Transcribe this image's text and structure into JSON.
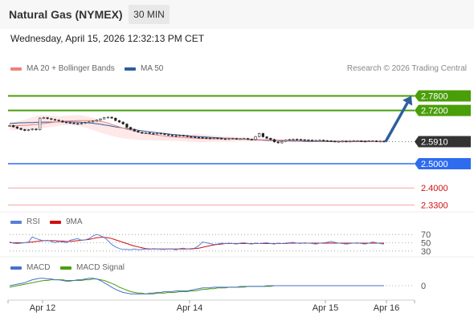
{
  "header": {
    "title": "Natural Gas (NYMEX)",
    "timeframe": "30 MIN"
  },
  "datetime": "Wednesday, April 15, 2026 12:32:13 PM CET",
  "legend": {
    "ma20": "MA 20 + Bollinger Bands",
    "ma50": "MA 50",
    "rsi": "RSI",
    "rsi_ma": "9MA",
    "macd": "MACD",
    "macd_signal": "MACD Signal"
  },
  "credit": "Research © 2026 Trading Central",
  "colors": {
    "resistance": "#4a9e0a",
    "support": "#2f6bef",
    "support_weak": "#f4a6a6",
    "current": "#333333",
    "ma20": "#f08080",
    "ma50": "#2e5e9e",
    "bollinger_fill": "#fde0e0",
    "rsi": "#5b7fd6",
    "rsi_ma": "#d01010",
    "macd": "#4a6fd0",
    "macd_signal": "#4a9e0a",
    "arrow": "#2e5e9e",
    "up_candle": "#1c1c1c",
    "down_candle": "#c0392b"
  },
  "chart_data": [
    {
      "type": "candlestick",
      "title": "Natural Gas (NYMEX)",
      "timeframe": "30 MIN",
      "x_ticks": [
        "Apr 12",
        "Apr 14",
        "Apr 15",
        "Apr 16"
      ],
      "price_levels": [
        {
          "label": "2.7800",
          "value": 2.78,
          "kind": "resistance"
        },
        {
          "label": "2.7200",
          "value": 2.72,
          "kind": "resistance"
        },
        {
          "label": "2.5910",
          "value": 2.591,
          "kind": "current"
        },
        {
          "label": "2.5000",
          "value": 2.5,
          "kind": "support"
        },
        {
          "label": "2.4000",
          "value": 2.4,
          "kind": "support_weak"
        },
        {
          "label": "2.3300",
          "value": 2.33,
          "kind": "support_weak"
        }
      ],
      "ylim": [
        2.308,
        2.861
      ],
      "close_series": [
        2.658,
        2.652,
        2.646,
        2.641,
        2.637,
        2.64,
        2.643,
        2.64,
        2.688,
        2.69,
        2.686,
        2.683,
        2.68,
        2.677,
        2.672,
        2.67,
        2.668,
        2.666,
        2.664,
        2.667,
        2.67,
        2.673,
        2.676,
        2.68,
        2.685,
        2.69,
        2.692,
        2.688,
        2.678,
        2.672,
        2.664,
        2.65,
        2.642,
        2.635,
        2.63,
        2.626,
        2.628,
        2.625,
        2.623,
        2.626,
        2.624,
        2.62,
        2.618,
        2.616,
        2.614,
        2.617,
        2.615,
        2.612,
        2.611,
        2.609,
        2.608,
        2.607,
        2.606,
        2.605,
        2.606,
        2.605,
        2.603,
        2.602,
        2.603,
        2.604,
        2.603,
        2.603,
        2.604,
        2.601,
        2.6,
        2.612,
        2.625,
        2.611,
        2.605,
        2.6,
        2.59,
        2.586,
        2.592,
        2.597,
        2.6,
        2.601,
        2.6,
        2.599,
        2.598,
        2.597,
        2.596,
        2.596,
        2.597,
        2.595,
        2.594,
        2.593,
        2.592,
        2.592,
        2.593,
        2.592,
        2.593,
        2.594,
        2.594,
        2.593,
        2.592,
        2.594,
        2.594,
        2.592,
        2.593,
        2.591
      ],
      "ma20": [
        2.655,
        2.656,
        2.657,
        2.658,
        2.658,
        2.659,
        2.661,
        2.662,
        2.664,
        2.666,
        2.668,
        2.67,
        2.672,
        2.673,
        2.675,
        2.676,
        2.677,
        2.677,
        2.678,
        2.678,
        2.678,
        2.678,
        2.678,
        2.677,
        2.675,
        2.672,
        2.668,
        2.662,
        2.657,
        2.652,
        2.647,
        2.642,
        2.638,
        2.634,
        2.631,
        2.628,
        2.625,
        2.622,
        2.62,
        2.618,
        2.616,
        2.614,
        2.612,
        2.611,
        2.61,
        2.609,
        2.608,
        2.607,
        2.606,
        2.605,
        2.604,
        2.604,
        2.603,
        2.603,
        2.603,
        2.603,
        2.604,
        2.605,
        2.605,
        2.605,
        2.604,
        2.603,
        2.602,
        2.601,
        2.6,
        2.599,
        2.599,
        2.598,
        2.598,
        2.598,
        2.597,
        2.597,
        2.597,
        2.596,
        2.596,
        2.596,
        2.595,
        2.595,
        2.595,
        2.595,
        2.594,
        2.594,
        2.594,
        2.594,
        2.594,
        2.593,
        2.593,
        2.593,
        2.593,
        2.593,
        2.593,
        2.593,
        2.593,
        2.593,
        2.593,
        2.593,
        2.592,
        2.592,
        2.592,
        2.592
      ],
      "ma50": [
        2.666,
        2.667,
        2.668,
        2.669,
        2.669,
        2.67,
        2.67,
        2.671,
        2.671,
        2.672,
        2.672,
        2.672,
        2.672,
        2.673,
        2.673,
        2.673,
        2.673,
        2.672,
        2.672,
        2.671,
        2.67,
        2.669,
        2.667,
        2.665,
        2.663,
        2.66,
        2.658,
        2.655,
        2.652,
        2.65,
        2.647,
        2.645,
        2.643,
        2.641,
        2.638,
        2.636,
        2.634,
        2.632,
        2.63,
        2.628,
        2.626,
        2.625,
        2.623,
        2.621,
        2.62,
        2.618,
        2.617,
        2.616,
        2.614,
        2.613,
        2.612,
        2.611,
        2.61,
        2.609,
        2.608,
        2.607,
        2.606,
        2.605,
        2.605,
        2.604,
        2.603,
        2.602,
        2.601,
        2.6,
        2.599,
        2.598,
        2.598,
        2.597,
        2.596,
        2.596,
        2.595,
        2.595,
        2.594,
        2.594,
        2.594,
        2.593,
        2.593,
        2.593,
        2.592,
        2.592,
        2.592,
        2.592,
        2.592,
        2.592,
        2.592,
        2.591,
        2.591,
        2.591,
        2.591,
        2.591,
        2.591,
        2.591,
        2.591,
        2.591,
        2.591,
        2.591,
        2.591,
        2.591,
        2.591,
        2.591
      ],
      "bollinger_upper": [
        2.672,
        2.673,
        2.675,
        2.678,
        2.682,
        2.687,
        2.692,
        2.697,
        2.7,
        2.7,
        2.699,
        2.698,
        2.697,
        2.696,
        2.697,
        2.698,
        2.699,
        2.7,
        2.701,
        2.7,
        2.697,
        2.694,
        2.69,
        2.685,
        2.679,
        2.673,
        2.667,
        2.66,
        2.654,
        2.648,
        2.643,
        2.638,
        2.634,
        2.63,
        2.627,
        2.624,
        2.621,
        2.619,
        2.616,
        2.614,
        2.613,
        2.612,
        2.611,
        2.61,
        2.61,
        2.612,
        2.615,
        2.619,
        2.622,
        2.624,
        2.624,
        2.622,
        2.62,
        2.618,
        2.617,
        2.616,
        2.614,
        2.613,
        2.612,
        2.611,
        2.61,
        2.609,
        2.608,
        2.607,
        2.606,
        2.605,
        2.605,
        2.604,
        2.604,
        2.603,
        2.603,
        2.602,
        2.602,
        2.602,
        2.601,
        2.601,
        2.601,
        2.601,
        2.6,
        2.6,
        2.6,
        2.6,
        2.6,
        2.599,
        2.599,
        2.599,
        2.599,
        2.599,
        2.599,
        2.599,
        2.598,
        2.598,
        2.598,
        2.598,
        2.598,
        2.598,
        2.598,
        2.598,
        2.598,
        2.598
      ],
      "bollinger_lower": [
        2.638,
        2.638,
        2.639,
        2.64,
        2.64,
        2.641,
        2.642,
        2.643,
        2.645,
        2.647,
        2.65,
        2.652,
        2.654,
        2.656,
        2.658,
        2.659,
        2.659,
        2.658,
        2.656,
        2.653,
        2.649,
        2.644,
        2.639,
        2.634,
        2.629,
        2.624,
        2.619,
        2.615,
        2.611,
        2.608,
        2.605,
        2.603,
        2.601,
        2.6,
        2.599,
        2.598,
        2.597,
        2.597,
        2.596,
        2.596,
        2.595,
        2.595,
        2.595,
        2.594,
        2.594,
        2.593,
        2.592,
        2.591,
        2.59,
        2.589,
        2.588,
        2.588,
        2.589,
        2.589,
        2.59,
        2.59,
        2.591,
        2.591,
        2.591,
        2.591,
        2.592,
        2.592,
        2.592,
        2.592,
        2.592,
        2.593,
        2.593,
        2.593,
        2.593,
        2.593,
        2.592,
        2.592,
        2.592,
        2.592,
        2.592,
        2.592,
        2.592,
        2.591,
        2.591,
        2.591,
        2.591,
        2.591,
        2.591,
        2.591,
        2.591,
        2.59,
        2.59,
        2.59,
        2.59,
        2.59,
        2.59,
        2.59,
        2.59,
        2.59,
        2.59,
        2.59,
        2.59,
        2.59,
        2.59,
        2.59
      ],
      "projection": {
        "from": 2.591,
        "to": 2.78,
        "direction": "up"
      }
    },
    {
      "type": "line",
      "name": "RSI",
      "levels": [
        {
          "label": "70",
          "value": 70
        },
        {
          "label": "50",
          "value": 50
        },
        {
          "label": "30",
          "value": 30
        }
      ],
      "ylim": [
        20,
        80
      ],
      "series": [
        {
          "name": "RSI",
          "values": [
            52,
            49,
            48,
            49,
            50,
            52,
            64,
            60,
            57,
            55,
            56,
            53,
            50,
            53,
            52,
            50,
            56,
            58,
            60,
            56,
            57,
            60,
            66,
            70,
            67,
            63,
            55,
            46,
            40,
            36,
            34,
            34,
            33,
            35,
            33,
            34,
            35,
            34,
            36,
            35,
            34,
            34,
            35,
            35,
            33,
            36,
            37,
            35,
            36,
            37,
            43,
            52,
            50,
            48,
            46,
            47,
            49,
            48,
            49,
            48,
            47,
            49,
            50,
            48,
            47,
            49,
            48,
            49,
            50,
            48,
            47,
            49,
            48,
            49,
            50,
            51,
            49,
            48,
            50,
            49,
            48,
            47,
            49,
            50,
            51,
            53,
            51,
            49,
            48,
            47,
            48,
            49,
            50,
            48,
            47,
            49,
            52,
            50,
            48,
            47
          ]
        },
        {
          "name": "9MA",
          "values": [
            50,
            50,
            50,
            50,
            50,
            51,
            52,
            53,
            54,
            55,
            55,
            55,
            55,
            54,
            54,
            53,
            53,
            54,
            55,
            56,
            57,
            58,
            60,
            62,
            63,
            63,
            62,
            60,
            57,
            54,
            51,
            48,
            45,
            42,
            40,
            38,
            36,
            35,
            35,
            35,
            35,
            35,
            35,
            35,
            35,
            35,
            35,
            35,
            35,
            36,
            37,
            39,
            41,
            43,
            45,
            46,
            47,
            48,
            48,
            48,
            48,
            48,
            48,
            48,
            48,
            48,
            48,
            48,
            48,
            48,
            48,
            48,
            48,
            48,
            49,
            49,
            49,
            49,
            49,
            49,
            49,
            49,
            49,
            49,
            49,
            49,
            49,
            49,
            49,
            49,
            49,
            49,
            49,
            49,
            49,
            49,
            49,
            49,
            49,
            49
          ]
        }
      ]
    },
    {
      "type": "line",
      "name": "MACD",
      "levels": [
        {
          "label": "0",
          "value": 0
        }
      ],
      "ylim": [
        -0.014,
        0.014
      ],
      "series": [
        {
          "name": "MACD",
          "values": [
            0.0,
            0.001,
            0.002,
            0.003,
            0.004,
            0.006,
            0.008,
            0.009,
            0.01,
            0.01,
            0.009,
            0.009,
            0.008,
            0.008,
            0.007,
            0.006,
            0.006,
            0.007,
            0.008,
            0.008,
            0.009,
            0.01,
            0.01,
            0.009,
            0.007,
            0.004,
            0.001,
            -0.002,
            -0.005,
            -0.007,
            -0.009,
            -0.01,
            -0.011,
            -0.011,
            -0.011,
            -0.011,
            -0.011,
            -0.01,
            -0.01,
            -0.009,
            -0.009,
            -0.008,
            -0.008,
            -0.008,
            -0.007,
            -0.007,
            -0.007,
            -0.007,
            -0.006,
            -0.005,
            -0.004,
            -0.003,
            -0.003,
            -0.003,
            -0.002,
            -0.002,
            -0.002,
            -0.002,
            -0.002,
            -0.002,
            -0.002,
            -0.001,
            -0.001,
            -0.001,
            -0.001,
            -0.001,
            -0.001,
            -0.001,
            0.0,
            0.0,
            0.0,
            0.0,
            0.0,
            0.0,
            0.0,
            0.0,
            0.0,
            0.0,
            0.0,
            0.0,
            0.0,
            0.0,
            0.0,
            0.0,
            0.0,
            0.0,
            0.0,
            0.0,
            0.0,
            0.0,
            0.0,
            0.0,
            0.0,
            0.0,
            0.0,
            0.0,
            0.0,
            0.0,
            0.0,
            0.0
          ]
        },
        {
          "name": "MACD Signal",
          "values": [
            -0.002,
            -0.001,
            0.0,
            0.001,
            0.002,
            0.003,
            0.004,
            0.005,
            0.006,
            0.007,
            0.007,
            0.008,
            0.008,
            0.008,
            0.008,
            0.007,
            0.007,
            0.007,
            0.007,
            0.007,
            0.008,
            0.008,
            0.009,
            0.009,
            0.008,
            0.007,
            0.005,
            0.003,
            0.001,
            -0.002,
            -0.004,
            -0.006,
            -0.008,
            -0.009,
            -0.01,
            -0.01,
            -0.011,
            -0.011,
            -0.011,
            -0.01,
            -0.01,
            -0.01,
            -0.009,
            -0.009,
            -0.009,
            -0.008,
            -0.008,
            -0.008,
            -0.007,
            -0.007,
            -0.006,
            -0.005,
            -0.005,
            -0.004,
            -0.004,
            -0.003,
            -0.003,
            -0.003,
            -0.002,
            -0.002,
            -0.002,
            -0.002,
            -0.002,
            -0.001,
            -0.001,
            -0.001,
            -0.001,
            -0.001,
            -0.001,
            -0.001,
            0.0,
            0.0,
            0.0,
            0.0,
            0.0,
            0.0,
            0.0,
            0.0,
            0.0,
            0.0,
            0.0,
            0.0,
            0.0,
            0.0,
            0.0,
            0.0,
            0.0,
            0.0,
            0.0,
            0.0,
            0.0,
            0.0,
            0.0,
            0.0,
            0.0,
            0.0,
            0.0,
            0.0,
            0.0,
            0.0
          ]
        }
      ]
    }
  ]
}
